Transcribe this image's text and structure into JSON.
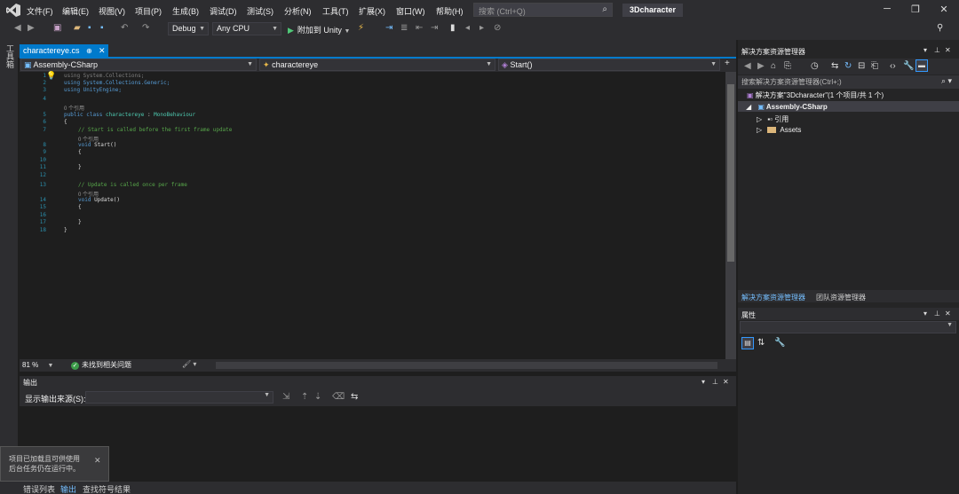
{
  "menubar": {
    "items": [
      "文件(F)",
      "编辑(E)",
      "视图(V)",
      "项目(P)",
      "生成(B)",
      "调试(D)",
      "测试(S)",
      "分析(N)",
      "工具(T)",
      "扩展(X)",
      "窗口(W)",
      "帮助(H)"
    ],
    "search_placeholder": "搜索 (Ctrl+Q)",
    "project_title": "3Dcharacter"
  },
  "toolbar": {
    "configuration": "Debug",
    "platform": "Any CPU",
    "attach_label": "附加到 Unity"
  },
  "left_strip": {
    "toolbox_label": "工具箱"
  },
  "editor": {
    "tab_name": "charactereye.cs",
    "nav": {
      "project": "Assembly-CSharp",
      "class": "charactereye",
      "member": "Start()"
    },
    "line_numbers": [
      "1",
      "2",
      "3",
      "4",
      "5",
      "6",
      "7",
      "8",
      "9",
      "10",
      "11",
      "12",
      "13",
      "14",
      "15",
      "16",
      "17",
      "18"
    ],
    "lines": {
      "l1": "using System.Collections;",
      "l2": "using System.Collections.Generic;",
      "l3": "using UnityEngine;",
      "ref_class": "0 个引用",
      "l5a": "public class ",
      "l5b": "charactereye",
      "l5c": " : ",
      "l5d": "MonoBehaviour",
      "l6": "{",
      "l7": "// Start is called before the first frame update",
      "ref_start": "0 个引用",
      "l8a": "void ",
      "l8b": "Start()",
      "l9": "{",
      "l11": "}",
      "l13": "// Update is called once per frame",
      "ref_update": "0 个引用",
      "l14a": "void ",
      "l14b": "Update()",
      "l15": "{",
      "l17": "}",
      "l18": "}"
    },
    "zoom": "81 %",
    "issues": "未找到相关问题"
  },
  "output": {
    "title": "输出",
    "source_label": "显示输出来源(S):",
    "source_value": ""
  },
  "bottom_tabs": [
    "错误列表",
    "输出",
    "查找符号结果"
  ],
  "toast": {
    "line1": "项目已加载且可供使用",
    "line2": "后台任务仍在运行中。"
  },
  "solution_explorer": {
    "title": "解决方案资源管理器",
    "search_placeholder": "搜索解决方案资源管理器(Ctrl+;)",
    "solution": "解决方案\"3Dcharacter\"(1 个项目/共 1 个)",
    "project": "Assembly-CSharp",
    "children": [
      "引用",
      "Assets"
    ],
    "tabs": [
      "解决方案资源管理器",
      "团队资源管理器"
    ]
  },
  "properties": {
    "title": "属性"
  },
  "colors": {
    "accent": "#007acc",
    "background": "#1e1e1e",
    "chrome": "#2d2d30",
    "keyword": "#569cd6",
    "comment": "#57a64a",
    "type": "#4ec9b0"
  }
}
